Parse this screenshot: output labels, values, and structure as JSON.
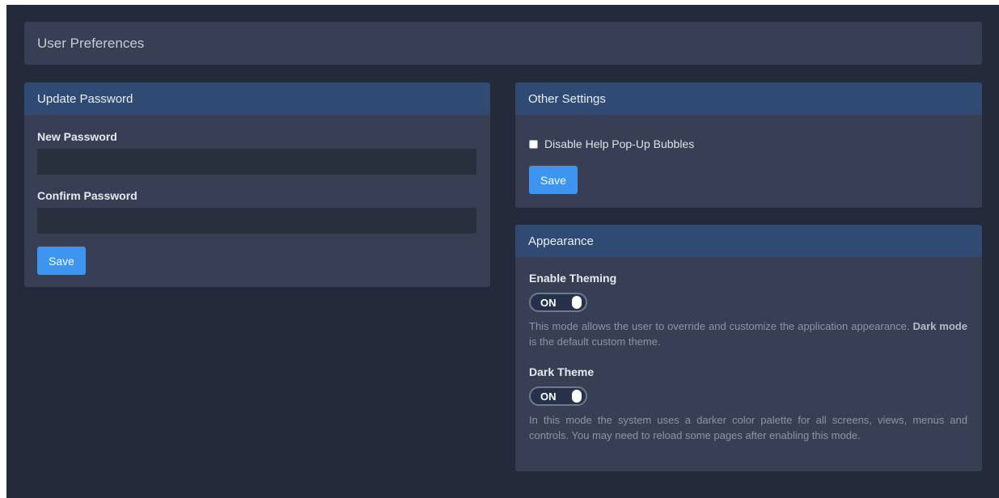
{
  "page": {
    "title": "User Preferences"
  },
  "update_password": {
    "title": "Update Password",
    "new_password_label": "New Password",
    "new_password_value": "",
    "confirm_password_label": "Confirm Password",
    "confirm_password_value": "",
    "save_label": "Save"
  },
  "other_settings": {
    "title": "Other Settings",
    "disable_help_label": "Disable Help Pop-Up Bubbles",
    "disable_help_checked": false,
    "save_label": "Save"
  },
  "appearance": {
    "title": "Appearance",
    "theming": {
      "label": "Enable Theming",
      "toggle_state": "ON",
      "description_prefix": "This mode allows the user to override and customize the application appearance.",
      "description_bold": "Dark mode",
      "description_suffix": "is the default custom theme."
    },
    "dark_theme": {
      "label": "Dark Theme",
      "toggle_state": "ON",
      "description": "In this mode the system uses a darker color palette for all screens, views, menus and controls. You may need to reload some pages after enabling this mode."
    }
  },
  "colors": {
    "background": "#252a3a",
    "panel": "#383f54",
    "panel_header": "#2f4b73",
    "input": "#2a2f3e",
    "accent_button": "#3e95f0"
  }
}
